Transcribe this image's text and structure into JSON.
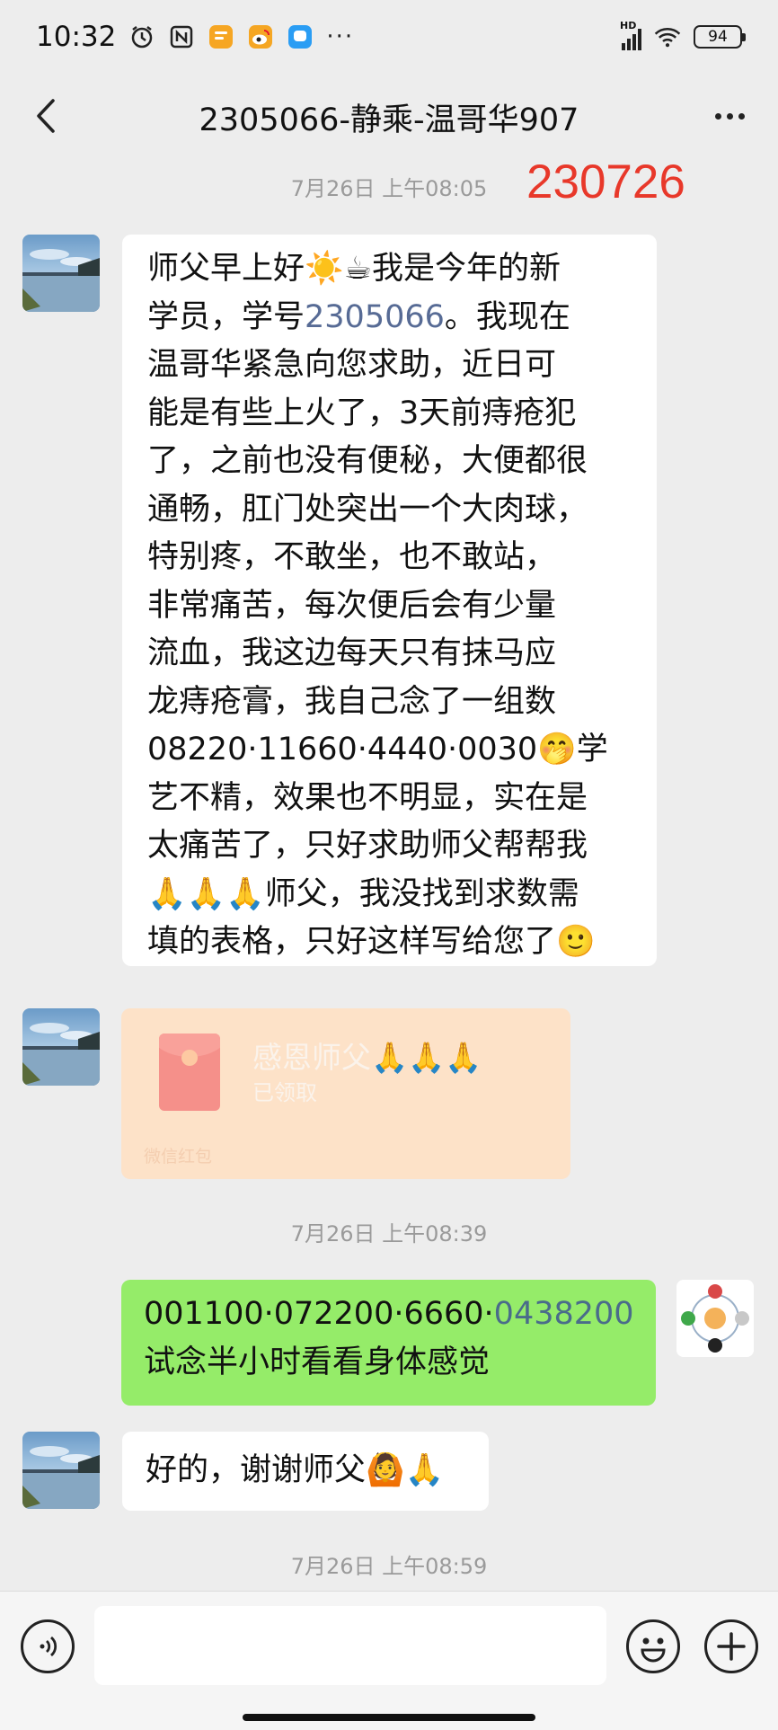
{
  "status_bar": {
    "time": "10:32",
    "left_icons": [
      "alarm-icon",
      "nfc-icon",
      "notes-app-icon",
      "weibo-icon",
      "chat-app-icon"
    ],
    "more": "···",
    "network": "HD",
    "battery": "94"
  },
  "nav": {
    "title": "2305066-静乘-温哥华907"
  },
  "annotation": "230726",
  "messages": {
    "t1": "7月26日 上午08:05",
    "m1_lines": [
      "师父早上好☀️☕我是今年的新",
      "学员，学号",
      "2305066",
      "。我现在",
      "温哥华紧急向您求助，近日可",
      "能是有些上火了，3天前痔疮犯",
      "了，之前也没有便秘，大便都很",
      "通畅，肛门处突出一个大肉球，",
      "特别疼，不敢坐，也不敢站，",
      "非常痛苦，每次便后会有少量",
      "流血，我这边每天只有抹马应",
      "龙痔疮膏，我自己念了一组数",
      "08220·11660·4440·0030🤭学",
      "艺不精，效果也不明显，实在是",
      "太痛苦了，只好求助师父帮帮我",
      "🙏🙏🙏师父，我没找到求数需",
      "填的表格，只好这样写给您了🙂"
    ],
    "redpacket": {
      "title": "感恩师父🙏🙏🙏",
      "status": "已领取",
      "label": "微信红包"
    },
    "t2": "7月26日 上午08:39",
    "m3_line1_a": "001100·072200·6660·",
    "m3_line1_b": "0438200",
    "m3_line2": "试念半小时看看身体感觉",
    "m4": "好的，谢谢师父🙆🙏",
    "t3": "7月26日 上午08:59"
  },
  "input": {
    "value": "",
    "placeholder": ""
  },
  "colors": {
    "background": "#ededed",
    "bubble_in": "#ffffff",
    "bubble_out": "#95ec69",
    "redpacket": "#fde2c8",
    "annotation": "#e8382a",
    "link": "#576b95"
  }
}
